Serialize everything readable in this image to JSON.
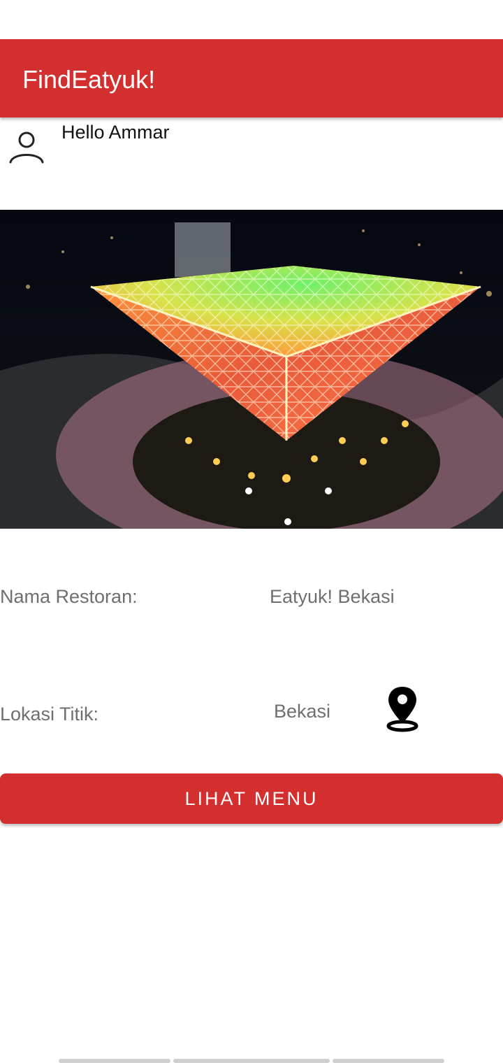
{
  "app_bar": {
    "title": "FindEatyuk!",
    "color": "#D32F2F"
  },
  "user": {
    "greeting": "Hello Ammar",
    "icon": "person-outline-icon"
  },
  "hero_image": {
    "description_icon": "landmark-photo"
  },
  "details": {
    "restaurant_label": "Nama Restoran:",
    "restaurant_value": "Eatyuk! Bekasi",
    "location_label": "Lokasi Titik:",
    "location_value": "Bekasi",
    "location_icon": "map-pin-icon"
  },
  "actions": {
    "menu_button_label": "LIHAT MENU"
  }
}
